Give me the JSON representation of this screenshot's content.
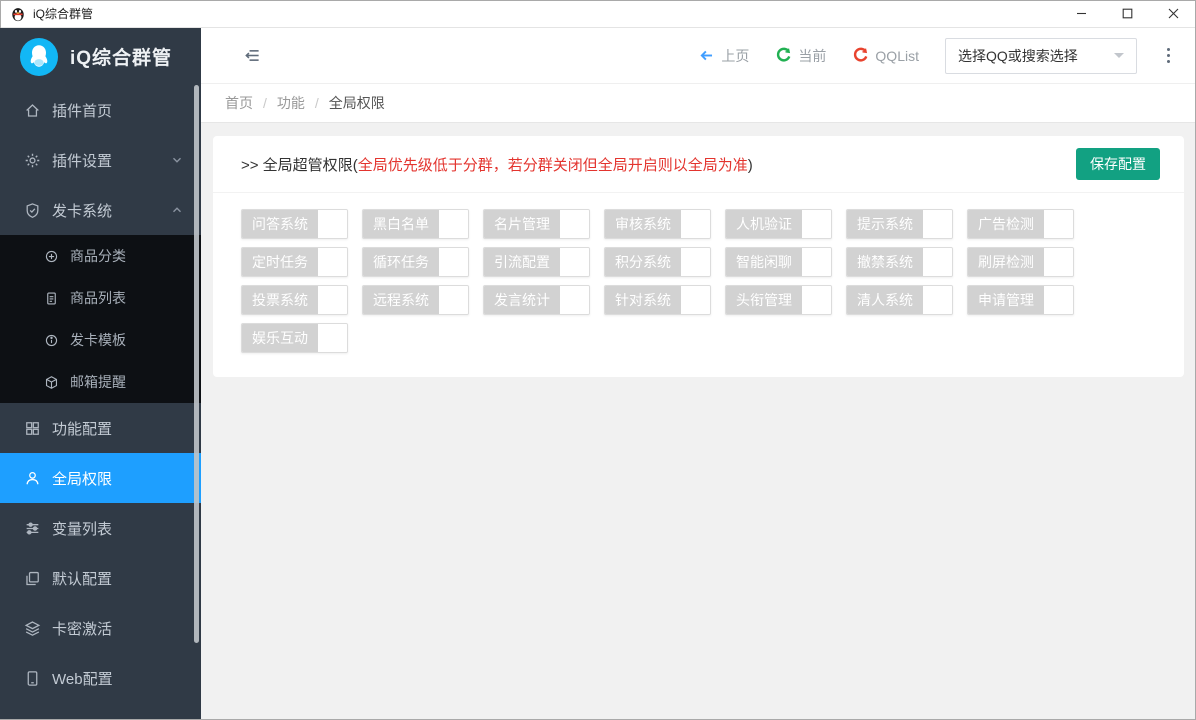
{
  "window": {
    "title": "iQ综合群管",
    "controls": [
      "minimize",
      "maximize",
      "close"
    ]
  },
  "colors": {
    "sidebar_bg": "#303a46",
    "submenu_bg": "#0d1014",
    "active_blue": "#1e9fff",
    "qq_blue": "#12b7f5",
    "toolbar_arrow_blue": "#409eff",
    "refresh_green": "#21b052",
    "refresh_red": "#e8432e",
    "save_teal": "#12a182",
    "warning_red": "#e3342e",
    "perm_gray": "#d2d2d2"
  },
  "sidebar": {
    "brand": "iQ综合群管",
    "items": [
      {
        "name": "plugin-home",
        "label": "插件首页",
        "icon": "home-icon"
      },
      {
        "name": "plugin-settings",
        "label": "插件设置",
        "icon": "gear-icon",
        "chevron": "down"
      },
      {
        "name": "card-system",
        "label": "发卡系统",
        "icon": "shield-check-icon",
        "chevron": "up",
        "children": [
          {
            "name": "product-category",
            "label": "商品分类",
            "icon": "circle-plus-icon"
          },
          {
            "name": "product-list",
            "label": "商品列表",
            "icon": "document-icon"
          },
          {
            "name": "card-template",
            "label": "发卡模板",
            "icon": "circle-info-icon"
          },
          {
            "name": "mail-reminder",
            "label": "邮箱提醒",
            "icon": "cube-icon"
          }
        ]
      },
      {
        "name": "function-config",
        "label": "功能配置",
        "icon": "blocks-icon"
      },
      {
        "name": "global-permissions",
        "label": "全局权限",
        "icon": "user-icon",
        "active": true
      },
      {
        "name": "variable-list",
        "label": "变量列表",
        "icon": "sliders-icon"
      },
      {
        "name": "default-config",
        "label": "默认配置",
        "icon": "copy-icon"
      },
      {
        "name": "card-key-activation",
        "label": "卡密激活",
        "icon": "layers-icon"
      },
      {
        "name": "web-config",
        "label": "Web配置",
        "icon": "tablet-icon"
      }
    ]
  },
  "toolbar": {
    "prev_label": "上页",
    "current_label": "当前",
    "qqlist_label": "QQList",
    "select_value": "选择QQ或搜索选择"
  },
  "breadcrumb": [
    "首页",
    "功能",
    "全局权限"
  ],
  "content": {
    "heading_prefix": ">> 全局超管权限(",
    "heading_warning": "全局优先级低于分群，若分群关闭但全局开启则以全局为准",
    "heading_suffix": ")",
    "save_button": "保存配置",
    "permissions": [
      "问答系统",
      "黑白名单",
      "名片管理",
      "审核系统",
      "人机验证",
      "提示系统",
      "广告检测",
      "定时任务",
      "循环任务",
      "引流配置",
      "积分系统",
      "智能闲聊",
      "撤禁系统",
      "刷屏检测",
      "投票系统",
      "远程系统",
      "发言统计",
      "针对系统",
      "头衔管理",
      "清人系统",
      "申请管理",
      "娱乐互动"
    ]
  }
}
